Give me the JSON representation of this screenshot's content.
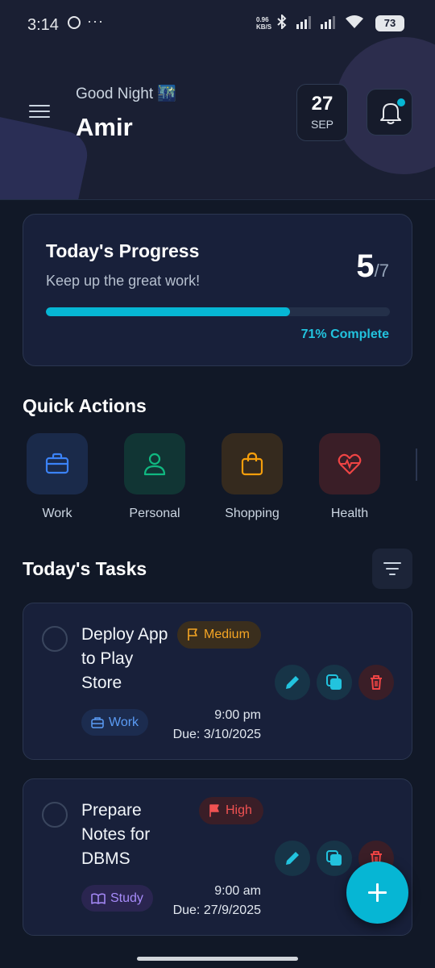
{
  "status_bar": {
    "time": "3:14",
    "net_speed_value": "0.96",
    "net_speed_unit": "KB/S",
    "battery": "73"
  },
  "header": {
    "greeting": "Good Night 🌃",
    "username": "Amir",
    "date_day": "27",
    "date_month": "SEP",
    "notification_dot": true
  },
  "progress": {
    "title": "Today's Progress",
    "subtitle": "Keep up the great work!",
    "completed": "5",
    "total": "/7",
    "fraction": 0.71,
    "percent_label": "71% Complete"
  },
  "quick_actions": {
    "title": "Quick Actions",
    "items": [
      {
        "label": "Work",
        "icon": "briefcase-icon",
        "color": "#3b82f6",
        "bg": "#1a2a4a"
      },
      {
        "label": "Personal",
        "icon": "person-icon",
        "color": "#10b981",
        "bg": "#113534"
      },
      {
        "label": "Shopping",
        "icon": "shopping-bag-icon",
        "color": "#f59e0b",
        "bg": "#352a1e"
      },
      {
        "label": "Health",
        "icon": "heart-pulse-icon",
        "color": "#ef4444",
        "bg": "#3a1e27"
      }
    ]
  },
  "tasks": {
    "title": "Today's Tasks",
    "items": [
      {
        "title": "Deploy App to Play Store",
        "priority": "Medium",
        "category": "Work",
        "time": "9:00 pm",
        "due": "Due: 3/10/2025"
      },
      {
        "title": "Prepare Notes for DBMS",
        "priority": "High",
        "category": "Study",
        "time": "9:00 am",
        "due": "Due: 27/9/2025"
      }
    ]
  },
  "colors": {
    "accent": "#06b6d4",
    "background": "#111827",
    "card": "#18203a"
  }
}
